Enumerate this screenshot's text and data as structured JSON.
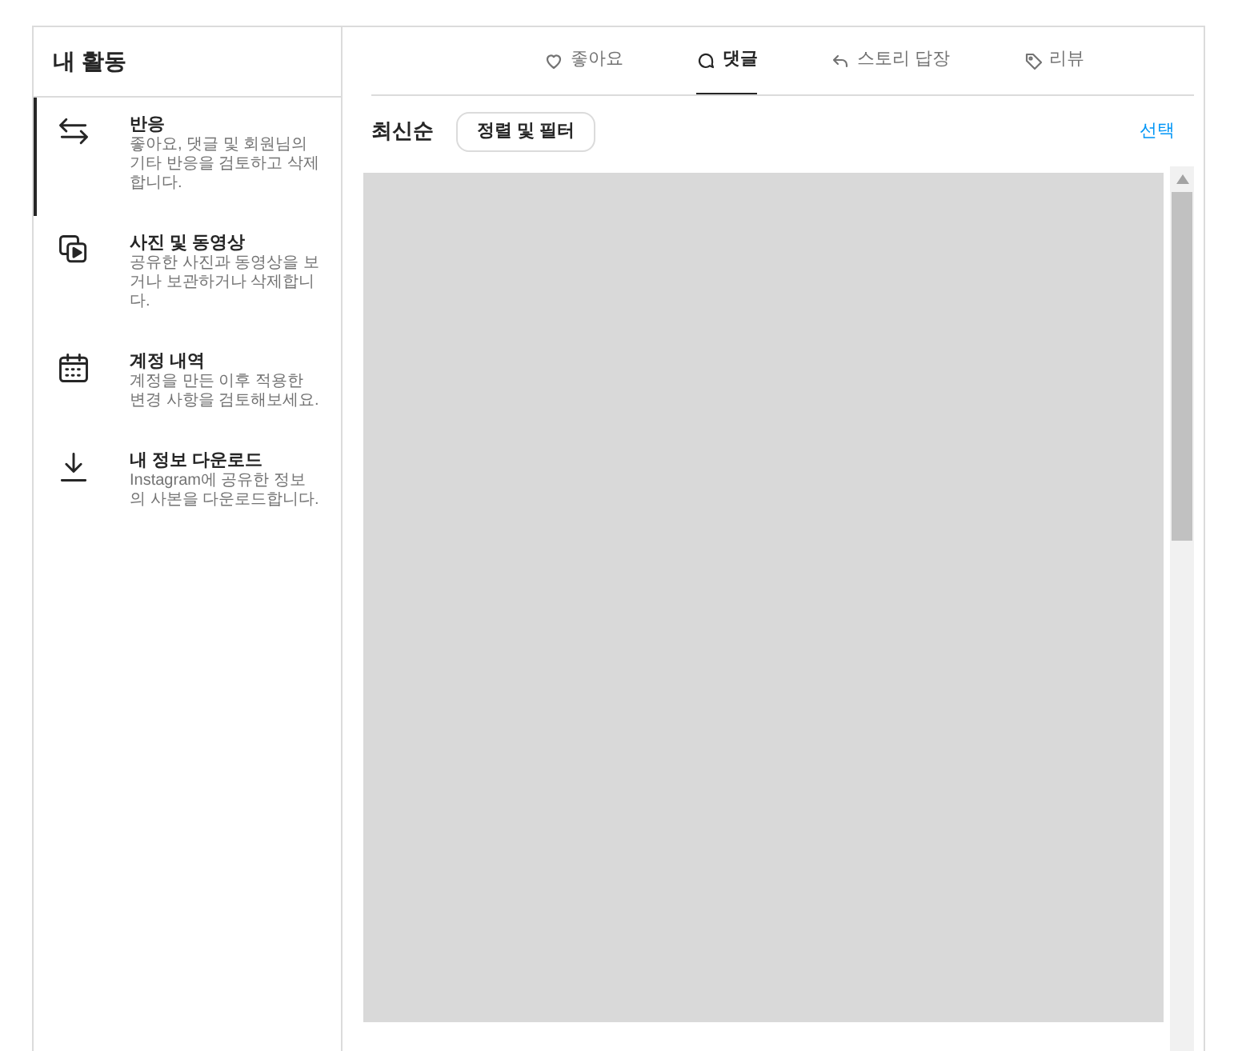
{
  "sidebar": {
    "title": "내 활동",
    "items": [
      {
        "kind": "interactions",
        "title": "반응",
        "description": "좋아요, 댓글 및 회원님의 기타 반응을 검토하고 삭제합니다.",
        "selected": true
      },
      {
        "kind": "media",
        "title": "사진 및 동영상",
        "description": "공유한 사진과 동영상을 보거나 보관하거나 삭제합니다.",
        "selected": false
      },
      {
        "kind": "history",
        "title": "계정 내역",
        "description": "계정을 만든 이후 적용한 변경 사항을 검토해보세요.",
        "selected": false
      },
      {
        "kind": "download",
        "title": "내 정보 다운로드",
        "description": "Instagram에 공유한 정보의 사본을 다운로드합니다.",
        "selected": false
      }
    ]
  },
  "tabs": [
    {
      "kind": "likes",
      "label": "좋아요",
      "selected": false
    },
    {
      "kind": "comments",
      "label": "댓글",
      "selected": true
    },
    {
      "kind": "story_replies",
      "label": "스토리 답장",
      "selected": false
    },
    {
      "kind": "reviews",
      "label": "리뷰",
      "selected": false
    }
  ],
  "toolbar": {
    "sort_label": "최신순",
    "filter_button": "정렬 및 필터",
    "select_link": "선택"
  }
}
